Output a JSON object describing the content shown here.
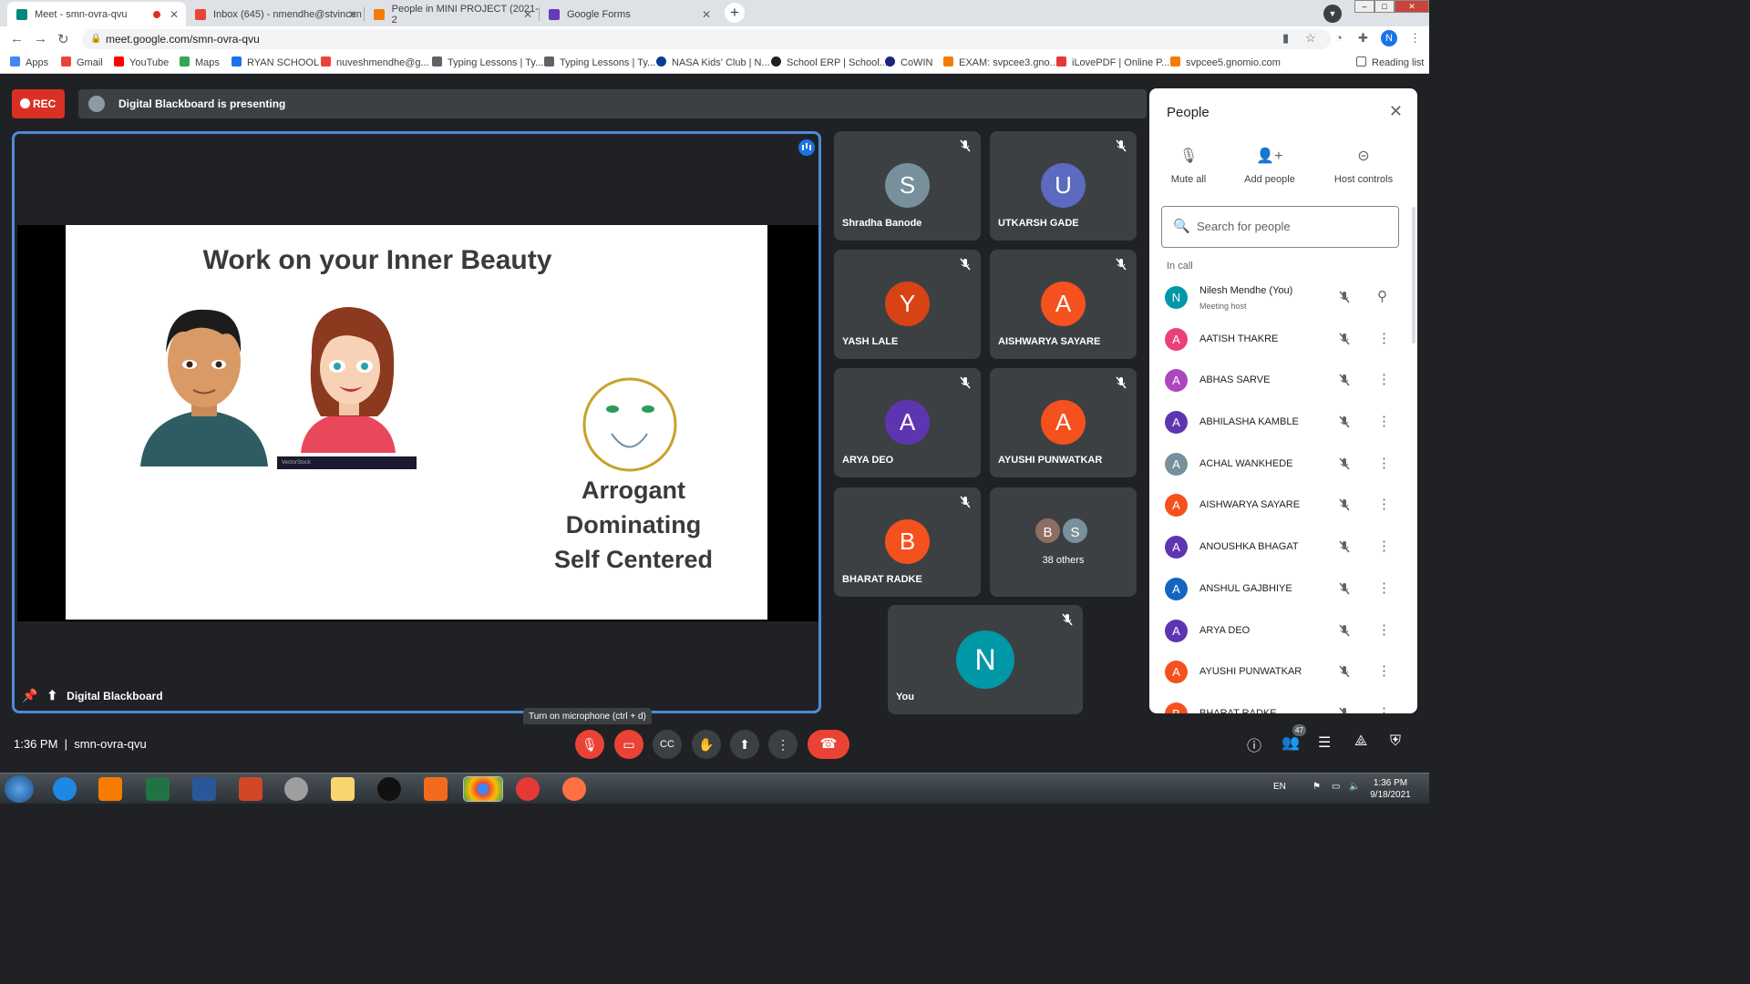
{
  "browser": {
    "tabs": [
      {
        "title": "Meet - smn-ovra-qvu",
        "icon": "meet-icon",
        "active": true
      },
      {
        "title": "Inbox (645) - nmendhe@stvincen",
        "icon": "gmail-icon"
      },
      {
        "title": "People in MINI PROJECT (2021-2",
        "icon": "classroom-icon"
      },
      {
        "title": "Google Forms",
        "icon": "forms-icon"
      }
    ],
    "url": "meet.google.com/smn-ovra-qvu",
    "profile_initial": "N",
    "bookmarks": [
      {
        "label": "Apps",
        "color": "#4285f4"
      },
      {
        "label": "Gmail",
        "color": "#ea4335"
      },
      {
        "label": "YouTube",
        "color": "#ff0000"
      },
      {
        "label": "Maps",
        "color": "#34a853"
      },
      {
        "label": "RYAN SCHOOL",
        "color": "#1a73e8"
      },
      {
        "label": "nuveshmendhe@g...",
        "color": "#ea4335"
      },
      {
        "label": "Typing Lessons | Ty...",
        "color": "#5f6368"
      },
      {
        "label": "Typing Lessons | Ty...",
        "color": "#5f6368"
      },
      {
        "label": "NASA Kids' Club | N...",
        "color": "#0b3d91"
      },
      {
        "label": "School ERP | School...",
        "color": "#202124"
      },
      {
        "label": "CoWIN",
        "color": "#1a237e"
      },
      {
        "label": "EXAM: svpcee3.gno...",
        "color": "#f57c00"
      },
      {
        "label": "iLovePDF | Online P...",
        "color": "#e53935"
      },
      {
        "label": "svpcee5.gnomio.com",
        "color": "#f57c00"
      }
    ],
    "reading_list": "Reading list"
  },
  "meet": {
    "rec_label": "REC",
    "presenting_text": "Digital Blackboard is presenting",
    "stage_name": "Digital Blackboard",
    "slide": {
      "title": "Work on your Inner Beauty",
      "words": [
        "Arrogant",
        "Dominating",
        "Self Centered"
      ],
      "watermark": "VectorStock"
    },
    "tiles": [
      {
        "initial": "S",
        "name": "Shradha Banode",
        "color": "#78909c"
      },
      {
        "initial": "U",
        "name": "UTKARSH GADE",
        "color": "#5c6bc0"
      },
      {
        "initial": "Y",
        "name": "YASH LALE",
        "color": "#d84315"
      },
      {
        "initial": "A",
        "name": "AISHWARYA SAYARE",
        "color": "#f4511e"
      },
      {
        "initial": "A",
        "name": "ARYA DEO",
        "color": "#5e35b1"
      },
      {
        "initial": "A",
        "name": "AYUSHI PUNWATKAR",
        "color": "#f4511e"
      },
      {
        "initial": "B",
        "name": "BHARAT RADKE",
        "color": "#f4511e"
      }
    ],
    "others": {
      "initials": [
        "B",
        "S"
      ],
      "colors": [
        "#8d6e63",
        "#78909c"
      ],
      "label": "38 others"
    },
    "self_tile": {
      "initial": "N",
      "name": "You",
      "color": "#0097a7"
    },
    "time": "1:36 PM",
    "meeting_code": "smn-ovra-qvu",
    "tooltip": "Turn on microphone (ctrl + d)",
    "participant_count": "47"
  },
  "people_panel": {
    "title": "People",
    "actions": [
      {
        "label": "Mute all",
        "icon": "mute-all-icon"
      },
      {
        "label": "Add people",
        "icon": "add-person-icon"
      },
      {
        "label": "Host controls",
        "icon": "toggle-icon"
      }
    ],
    "search_placeholder": "Search for people",
    "section_label": "In call",
    "participants": [
      {
        "initial": "N",
        "name": "Nilesh Mendhe (You)",
        "sub": "Meeting host",
        "color": "#0097a7"
      },
      {
        "initial": "A",
        "name": "AATISH THAKRE",
        "color": "#ec407a"
      },
      {
        "initial": "A",
        "name": "ABHAS SARVE",
        "color": "#ab47bc"
      },
      {
        "initial": "A",
        "name": "ABHILASHA KAMBLE",
        "color": "#5e35b1"
      },
      {
        "initial": "A",
        "name": "ACHAL WANKHEDE",
        "color": "#78909c"
      },
      {
        "initial": "A",
        "name": "AISHWARYA SAYARE",
        "color": "#f4511e"
      },
      {
        "initial": "A",
        "name": "ANOUSHKA BHAGAT",
        "color": "#5e35b1"
      },
      {
        "initial": "A",
        "name": "ANSHUL GAJBHIYE",
        "color": "#1565c0"
      },
      {
        "initial": "A",
        "name": "ARYA DEO",
        "color": "#5e35b1"
      },
      {
        "initial": "A",
        "name": "AYUSHI PUNWATKAR",
        "color": "#f4511e"
      },
      {
        "initial": "B",
        "name": "BHARAT RADKE",
        "color": "#f4511e"
      }
    ]
  },
  "taskbar": {
    "language": "EN",
    "clock_time": "1:36 PM",
    "clock_date": "9/18/2021"
  }
}
